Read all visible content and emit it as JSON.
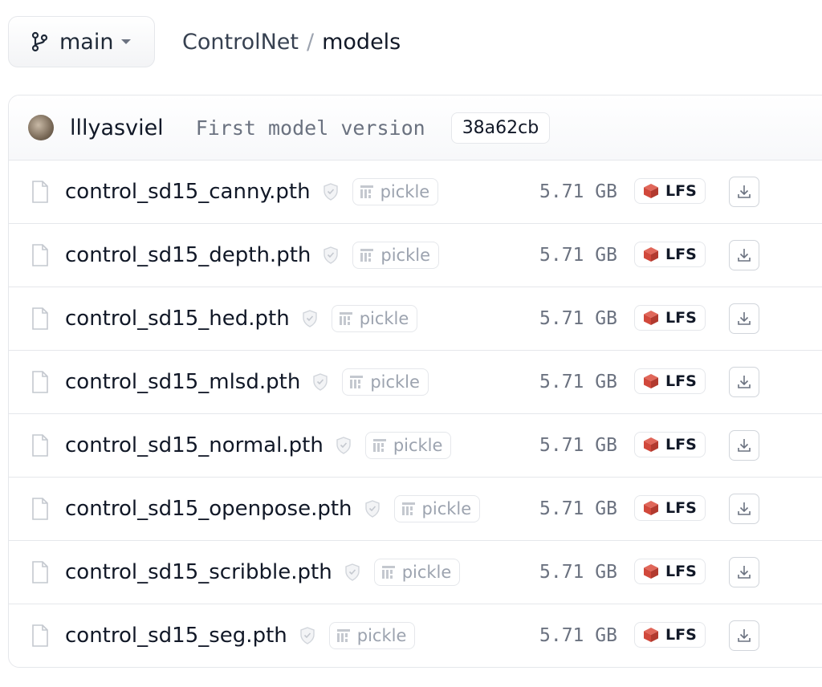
{
  "branch": {
    "name": "main",
    "icon": "git-branch-icon"
  },
  "breadcrumb": {
    "repo": "ControlNet",
    "separator": "/",
    "folder": "models"
  },
  "commit": {
    "author": "lllyasviel",
    "message": "First model version",
    "hash": "38a62cb"
  },
  "files": [
    {
      "name": "control_sd15_canny.pth",
      "badge": "pickle",
      "size": "5.71 GB",
      "lfs": "LFS"
    },
    {
      "name": "control_sd15_depth.pth",
      "badge": "pickle",
      "size": "5.71 GB",
      "lfs": "LFS"
    },
    {
      "name": "control_sd15_hed.pth",
      "badge": "pickle",
      "size": "5.71 GB",
      "lfs": "LFS"
    },
    {
      "name": "control_sd15_mlsd.pth",
      "badge": "pickle",
      "size": "5.71 GB",
      "lfs": "LFS"
    },
    {
      "name": "control_sd15_normal.pth",
      "badge": "pickle",
      "size": "5.71 GB",
      "lfs": "LFS"
    },
    {
      "name": "control_sd15_openpose.pth",
      "badge": "pickle",
      "size": "5.71 GB",
      "lfs": "LFS"
    },
    {
      "name": "control_sd15_scribble.pth",
      "badge": "pickle",
      "size": "5.71 GB",
      "lfs": "LFS"
    },
    {
      "name": "control_sd15_seg.pth",
      "badge": "pickle",
      "size": "5.71 GB",
      "lfs": "LFS"
    }
  ],
  "colors": {
    "lfs_accent": "#d1483b",
    "muted": "#6b7280",
    "border": "#e5e7eb"
  }
}
